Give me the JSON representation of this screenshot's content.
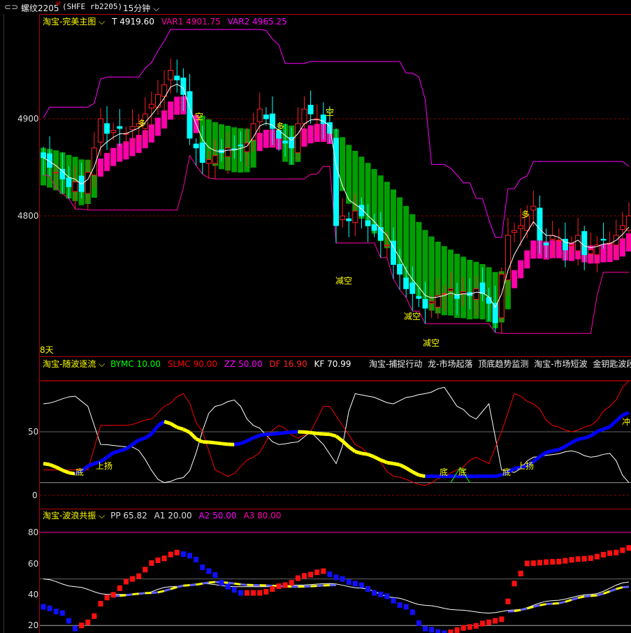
{
  "topbar": {
    "symbol": "螺纹2205",
    "flag": "M",
    "code": "(SHFE rb2205)",
    "period": "15分钟"
  },
  "main": {
    "title": "淘宝-完美主图",
    "T_label": "T",
    "T": "4919.60",
    "var1_label": "VAR1",
    "var1": "4901.75",
    "var2_label": "VAR2",
    "var2": "4965.25",
    "yticks": [
      "4900",
      "4800"
    ],
    "ytick_values": [
      4900,
      4800
    ],
    "annotations": {
      "duo1": "多",
      "kong1": "空",
      "duo2": "多",
      "kong2": "空",
      "jiankong1": "减空",
      "jiankong2": "减空",
      "jiankong3": "减空",
      "duo3": "多",
      "days": "8天"
    },
    "closes": [
      4860,
      4850,
      4845,
      4838,
      4830,
      4835,
      4825,
      4845,
      4870,
      4900,
      4885,
      4888,
      4890,
      4885,
      4892,
      4895,
      4905,
      4915,
      4925,
      4935,
      4950,
      4940,
      4925,
      4880,
      4870,
      4855,
      4858,
      4862,
      4865,
      4870,
      4868,
      4872,
      4875,
      4895,
      4910,
      4900,
      4890,
      4880,
      4875,
      4870,
      4895,
      4910,
      4905,
      4900,
      4895,
      4885,
      4790,
      4800,
      4795,
      4805,
      4800,
      4790,
      4785,
      4775,
      4770,
      4750,
      4740,
      4725,
      4720,
      4715,
      4705,
      4712,
      4718,
      4720,
      4725,
      4715,
      4722,
      4718,
      4725,
      4720,
      4710,
      4690,
      4740,
      4780,
      4785,
      4790,
      4800,
      4810,
      4775,
      4770,
      4780,
      4775,
      4765,
      4770,
      4780,
      4760,
      4765,
      4770,
      4775,
      4772,
      4780,
      4790,
      4800
    ]
  },
  "osc": {
    "title": "淘宝-随波逐流",
    "bymc_label": "BYMC",
    "bymc": "10.00",
    "slmc_label": "SLMC",
    "slmc": "90.00",
    "zz_label": "ZZ",
    "zz": "50.00",
    "df_label": "DF",
    "df": "16.90",
    "kf_label": "KF",
    "kf": "70.99",
    "links": [
      "淘宝-捕捉行动",
      "龙-市场起落",
      "顶底趋势监测",
      "淘宝-市场短波",
      "金钥匙波段"
    ],
    "yticks": [
      "50",
      "0"
    ],
    "annotations": {
      "di1": "底",
      "up1": "上扬",
      "di2": "底",
      "di3": "底",
      "di4": "底",
      "up2": "上扬",
      "chong": "冲"
    },
    "kf_points": [
      [
        0,
        72
      ],
      [
        5,
        78
      ],
      [
        7,
        70
      ],
      [
        9,
        40
      ],
      [
        14,
        38
      ],
      [
        19,
        10
      ],
      [
        22,
        14
      ],
      [
        27,
        70
      ],
      [
        30,
        75
      ],
      [
        33,
        55
      ],
      [
        37,
        40
      ],
      [
        40,
        42
      ],
      [
        42,
        50
      ],
      [
        44,
        40
      ],
      [
        46,
        25
      ],
      [
        49,
        80
      ],
      [
        51,
        78
      ],
      [
        55,
        72
      ],
      [
        57,
        77
      ],
      [
        60,
        80
      ],
      [
        63,
        85
      ],
      [
        65,
        70
      ],
      [
        68,
        60
      ],
      [
        70,
        72
      ],
      [
        72,
        20
      ],
      [
        74,
        18
      ],
      [
        77,
        30
      ],
      [
        80,
        32
      ],
      [
        83,
        35
      ],
      [
        86,
        30
      ],
      [
        89,
        33
      ],
      [
        92,
        10
      ]
    ],
    "df_points": [
      [
        0,
        20
      ],
      [
        7,
        20
      ],
      [
        9,
        55
      ],
      [
        13,
        55
      ],
      [
        17,
        60
      ],
      [
        19,
        70
      ],
      [
        22,
        80
      ],
      [
        25,
        50
      ],
      [
        27,
        20
      ],
      [
        29,
        15
      ],
      [
        33,
        30
      ],
      [
        37,
        55
      ],
      [
        40,
        45
      ],
      [
        42,
        50
      ],
      [
        44,
        70
      ],
      [
        45,
        70
      ],
      [
        47,
        55
      ],
      [
        49,
        40
      ],
      [
        52,
        30
      ],
      [
        55,
        15
      ],
      [
        60,
        8
      ],
      [
        63,
        15
      ],
      [
        65,
        20
      ],
      [
        68,
        30
      ],
      [
        70,
        25
      ],
      [
        72,
        50
      ],
      [
        74,
        80
      ],
      [
        77,
        72
      ],
      [
        80,
        55
      ],
      [
        83,
        50
      ],
      [
        86,
        55
      ],
      [
        89,
        70
      ],
      [
        92,
        90
      ]
    ],
    "trend_points": [
      [
        0,
        25
      ],
      [
        5,
        17
      ],
      [
        8,
        25
      ],
      [
        12,
        35
      ],
      [
        16,
        45
      ],
      [
        19,
        58
      ],
      [
        22,
        52
      ],
      [
        25,
        42
      ],
      [
        30,
        40
      ],
      [
        35,
        48
      ],
      [
        40,
        50
      ],
      [
        45,
        48
      ],
      [
        50,
        33
      ],
      [
        55,
        25
      ],
      [
        60,
        15
      ],
      [
        62,
        15
      ],
      [
        67,
        15
      ],
      [
        71,
        15
      ],
      [
        75,
        22
      ],
      [
        80,
        35
      ],
      [
        85,
        45
      ],
      [
        88,
        52
      ],
      [
        92,
        65
      ]
    ],
    "colors": {
      "bymc": "#00ff00",
      "slmc": "#ff0000",
      "zz": "#ff00ff",
      "df": "#ff0000",
      "kf": "#ffffff",
      "up": "#0000ff",
      "down": "#ffff00"
    }
  },
  "wave": {
    "title": "淘宝-波浪共振",
    "pp_label": "PP",
    "pp": "65.82",
    "a1_label": "A1",
    "a1": "20.00",
    "a2_label": "A2",
    "a2": "50.00",
    "a3_label": "A3",
    "a3": "80.00",
    "yticks": [
      "80",
      "60",
      "40",
      "20"
    ],
    "ytick_values": [
      80,
      60,
      40,
      20
    ],
    "pp_points": [
      [
        0,
        32
      ],
      [
        3,
        28
      ],
      [
        5,
        18
      ],
      [
        7,
        22
      ],
      [
        10,
        38
      ],
      [
        14,
        50
      ],
      [
        18,
        62
      ],
      [
        21,
        67
      ],
      [
        23,
        65
      ],
      [
        26,
        55
      ],
      [
        29,
        45
      ],
      [
        31,
        41
      ],
      [
        34,
        41
      ],
      [
        38,
        46
      ],
      [
        41,
        52
      ],
      [
        44,
        55
      ],
      [
        46,
        51
      ],
      [
        49,
        47
      ],
      [
        53,
        40
      ],
      [
        57,
        32
      ],
      [
        60,
        18
      ],
      [
        63,
        15
      ],
      [
        67,
        19
      ],
      [
        70,
        22
      ],
      [
        72,
        24
      ],
      [
        74,
        47
      ],
      [
        76,
        60
      ],
      [
        80,
        61
      ],
      [
        85,
        63
      ],
      [
        90,
        67
      ],
      [
        92,
        70
      ]
    ],
    "white_points": [
      [
        0,
        50
      ],
      [
        5,
        45
      ],
      [
        10,
        40
      ],
      [
        15,
        40
      ],
      [
        20,
        45
      ],
      [
        25,
        47
      ],
      [
        30,
        45
      ],
      [
        35,
        45
      ],
      [
        40,
        46
      ],
      [
        45,
        47
      ],
      [
        50,
        44
      ],
      [
        55,
        38
      ],
      [
        60,
        33
      ],
      [
        65,
        30
      ],
      [
        70,
        28
      ],
      [
        74,
        30
      ],
      [
        80,
        36
      ],
      [
        86,
        40
      ],
      [
        92,
        48
      ]
    ],
    "yellow_points": [
      [
        11,
        39
      ],
      [
        17,
        41
      ],
      [
        23,
        46
      ],
      [
        27,
        48
      ],
      [
        33,
        46
      ],
      [
        40,
        45
      ],
      [
        46,
        46
      ]
    ],
    "yellow_points2": [
      [
        73,
        29
      ],
      [
        80,
        34
      ],
      [
        86,
        39
      ],
      [
        92,
        45
      ]
    ]
  }
}
